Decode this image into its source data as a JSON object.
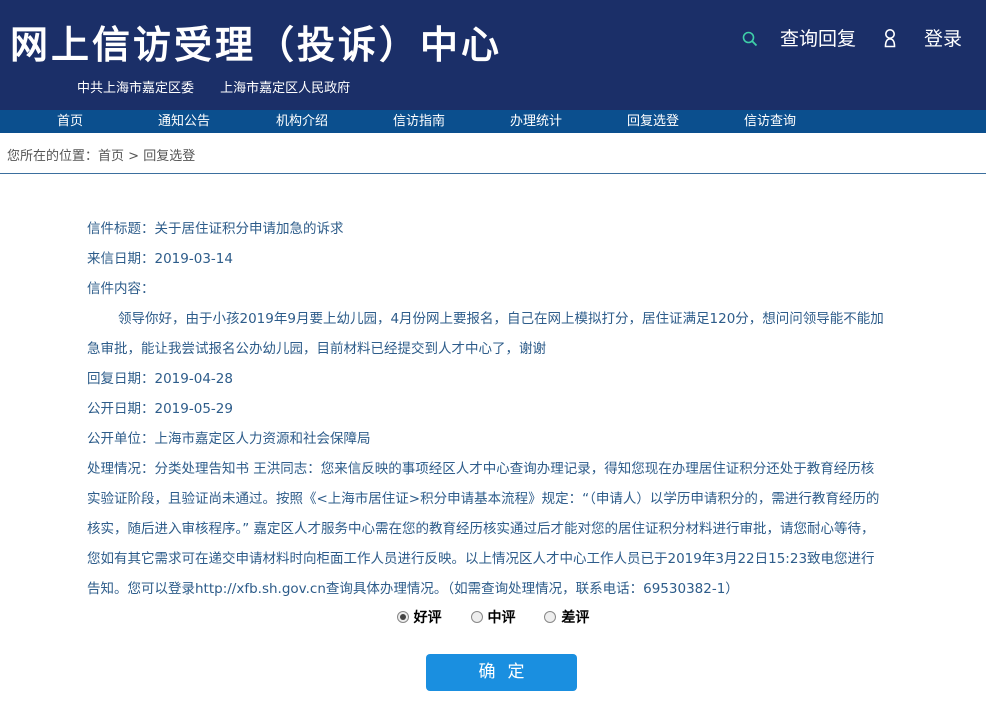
{
  "header": {
    "site_title": "网上信访受理（投诉）中心",
    "orgs": [
      "中共上海市嘉定区委",
      "上海市嘉定区人民政府"
    ],
    "query_label": "查询回复",
    "login_label": "登录",
    "search_icon": "search-icon",
    "user_icon": "user-icon"
  },
  "nav": {
    "items": [
      "首页",
      "通知公告",
      "机构介绍",
      "信访指南",
      "办理统计",
      "回复选登",
      "信访查询"
    ]
  },
  "breadcrumb": {
    "prefix": "您所在的位置：",
    "home": "首页",
    "sep": " > ",
    "current": "回复选登"
  },
  "letter": {
    "title_label": "信件标题：",
    "title": "关于居住证积分申请加急的诉求",
    "date_label": "来信日期：",
    "date": "2019-03-14",
    "content_label": "信件内容：",
    "content": "领导你好，由于小孩2019年9月要上幼儿园，4月份网上要报名，自己在网上模拟打分，居住证满足120分，想问问领导能不能加急审批，能让我尝试报名公办幼儿园，目前材料已经提交到人才中心了，谢谢",
    "reply_date_label": "回复日期：",
    "reply_date": "2019-04-28",
    "public_date_label": "公开日期：",
    "public_date": "2019-05-29",
    "unit_label": "公开单位：",
    "unit": "上海市嘉定区人力资源和社会保障局",
    "handling_label": "处理情况：",
    "handling": "分类处理告知书 王洪同志：您来信反映的事项经区人才中心查询办理记录，得知您现在办理居住证积分还处于教育经历核实验证阶段，且验证尚未通过。按照《<上海市居住证>积分申请基本流程》规定：“（申请人）以学历申请积分的，需进行教育经历的核实，随后进入审核程序。” 嘉定区人才服务中心需在您的教育经历核实通过后才能对您的居住证积分材料进行审批，请您耐心等待，您如有其它需求可在递交申请材料时向柜面工作人员进行反映。以上情况区人才中心工作人员已于2019年3月22日15:23致电您进行告知。您可以登录http://xfb.sh.gov.cn查询具体办理情况。（如需查询处理情况，联系电话：69530382-1）"
  },
  "rating": {
    "options": [
      "好评",
      "中评",
      "差评"
    ],
    "selected": "好评"
  },
  "confirm_label": "确定",
  "colors": {
    "header_bg": "#1b2f68",
    "nav_bg": "#0b4f8e",
    "text_blue": "#2d5c8a",
    "button_bg": "#1a8fe0"
  }
}
